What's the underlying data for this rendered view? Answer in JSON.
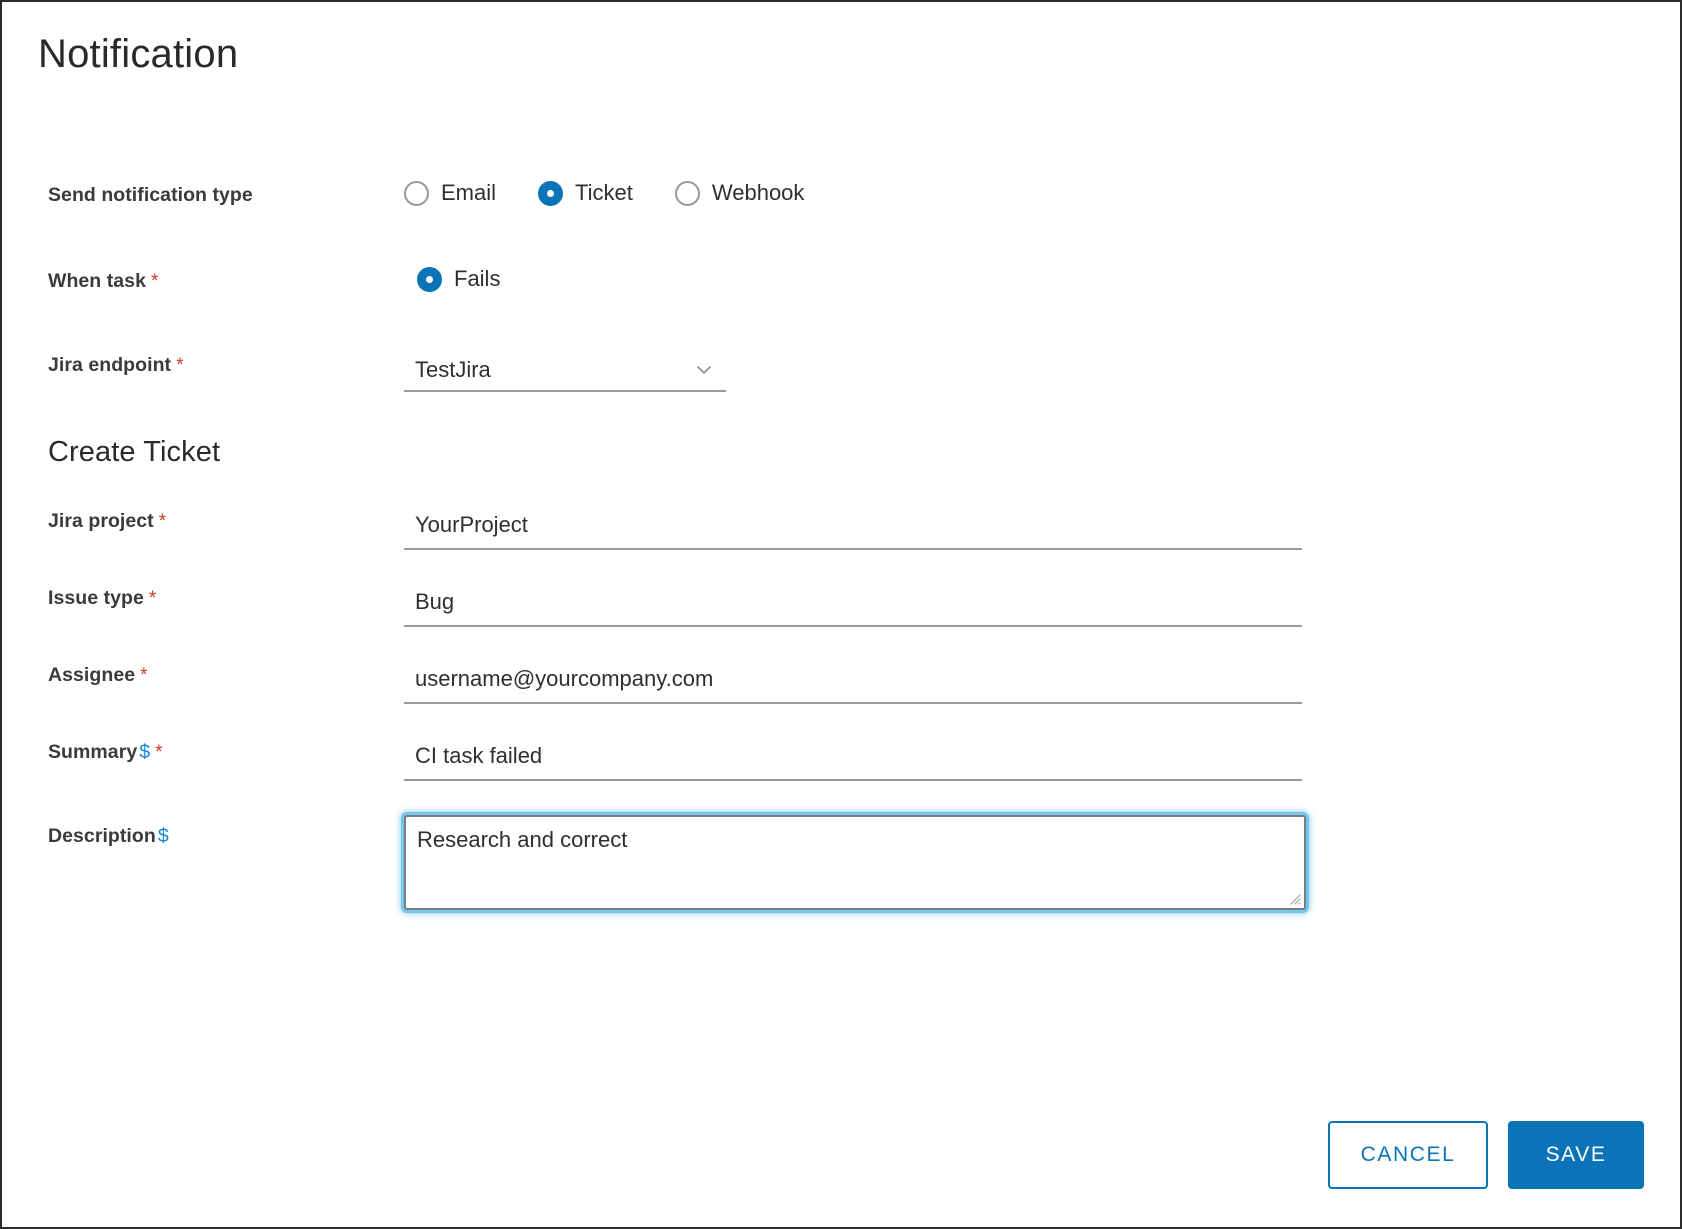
{
  "page": {
    "title": "Notification"
  },
  "notification_type": {
    "label": "Send notification type",
    "options": [
      {
        "label": "Email",
        "selected": false
      },
      {
        "label": "Ticket",
        "selected": true
      },
      {
        "label": "Webhook",
        "selected": false
      }
    ]
  },
  "when_task": {
    "label": "When task",
    "required_marker": "*",
    "options": [
      {
        "label": "Fails",
        "selected": true
      }
    ]
  },
  "jira_endpoint": {
    "label": "Jira endpoint",
    "required_marker": "*",
    "value": "TestJira",
    "chevron_icon": "chevron-down-icon"
  },
  "create_ticket": {
    "heading": "Create Ticket",
    "fields": [
      {
        "label": "Jira project",
        "required_marker": "*",
        "dollar_token": "",
        "value": "YourProject",
        "placeholder": ""
      },
      {
        "label": "Issue type",
        "required_marker": "*",
        "dollar_token": "",
        "value": "Bug",
        "placeholder": ""
      },
      {
        "label": "Assignee",
        "required_marker": "*",
        "dollar_token": "",
        "value": "username@yourcompany.com",
        "placeholder": ""
      },
      {
        "label": "Summary",
        "required_marker": "*",
        "dollar_token": "$",
        "value": "CI task failed",
        "placeholder": ""
      }
    ],
    "description": {
      "label": "Description",
      "required_marker": "",
      "dollar_token": "$",
      "value": "Research and correct",
      "placeholder": "",
      "focused": true
    }
  },
  "footer": {
    "cancel_label": "CANCEL",
    "save_label": "SAVE"
  },
  "colors": {
    "accent_blue": "#0b74b8",
    "required_red": "#c9401e",
    "token_blue": "#0f87d6",
    "focus_glow": "#5cbae9",
    "underline_grey": "#9a9a9a"
  }
}
